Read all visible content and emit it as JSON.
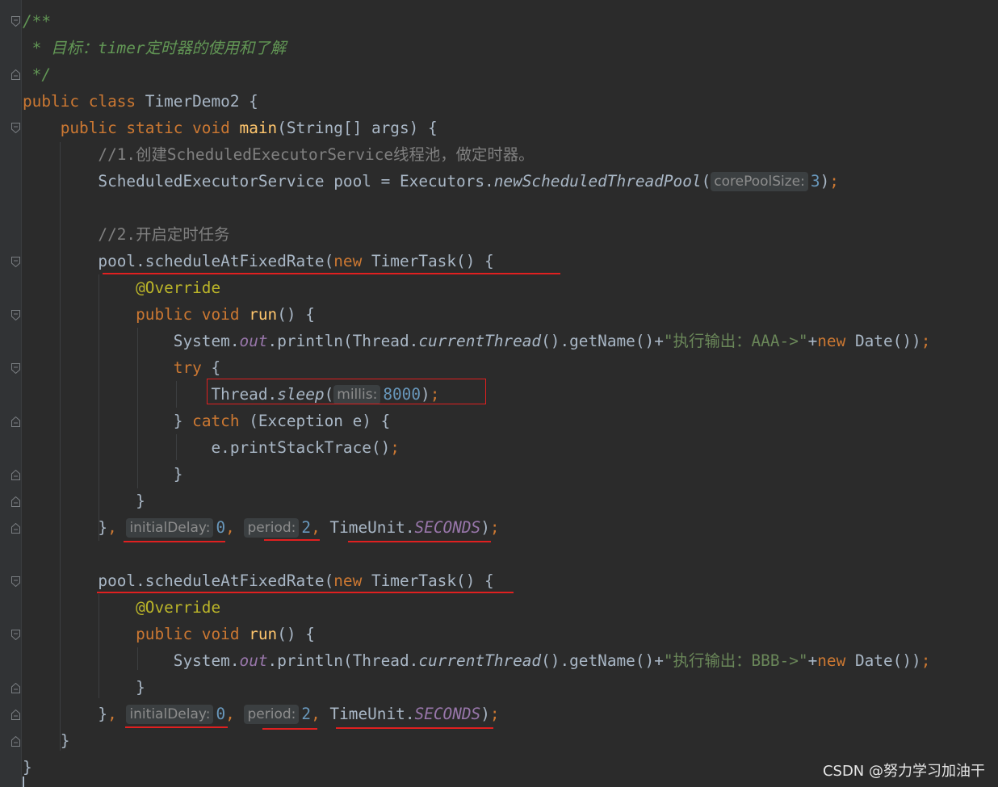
{
  "colors": {
    "background": "#2b2b2b",
    "keyword": "#cc7832",
    "doc_comment": "#629755",
    "line_comment": "#808080",
    "method_decl": "#ffc66d",
    "static_field": "#9876aa",
    "number": "#6897bb",
    "string": "#6a8759",
    "annotation": "#bbb529",
    "plain": "#a9b7c6",
    "highlight": "#e02020"
  },
  "editor": {
    "lines": [
      {
        "i": 0,
        "tokens": [
          {
            "t": "/**",
            "c": "doc_comment",
            "it": true
          }
        ]
      },
      {
        "i": 1,
        "tokens": [
          {
            "t": " * 目标：timer定时器的使用和了解",
            "c": "doc_comment",
            "it": true
          }
        ]
      },
      {
        "i": 2,
        "tokens": [
          {
            "t": " */",
            "c": "doc_comment",
            "it": true
          }
        ]
      },
      {
        "i": 3,
        "tokens": [
          {
            "t": "public class ",
            "c": "keyword"
          },
          {
            "t": "TimerDemo2 {",
            "c": "plain"
          }
        ]
      },
      {
        "i": 4,
        "tokens": [
          {
            "t": "    public static void ",
            "c": "keyword"
          },
          {
            "t": "main",
            "c": "method_decl"
          },
          {
            "t": "(String[] args) {",
            "c": "plain"
          }
        ]
      },
      {
        "i": 5,
        "tokens": [
          {
            "t": "        //1.创建ScheduledExecutorService线程池，做定时器。",
            "c": "line_comment"
          }
        ]
      },
      {
        "i": 6,
        "tokens": [
          {
            "t": "        ScheduledExecutorService pool = Executors.",
            "c": "plain"
          },
          {
            "t": "newScheduledThreadPool",
            "c": "plain",
            "it": true
          },
          {
            "t": "(",
            "c": "plain"
          },
          {
            "hint": "corePoolSize:"
          },
          {
            "t": "3",
            "c": "number"
          },
          {
            "t": ")",
            "c": "plain"
          },
          {
            "t": ";",
            "c": "keyword"
          }
        ]
      },
      {
        "i": 7,
        "tokens": []
      },
      {
        "i": 8,
        "tokens": [
          {
            "t": "        //2.开启定时任务",
            "c": "line_comment"
          }
        ]
      },
      {
        "i": 9,
        "tokens": [
          {
            "t": "        pool.scheduleAtFixedRate(",
            "c": "plain"
          },
          {
            "t": "new ",
            "c": "keyword"
          },
          {
            "t": "TimerTask() {",
            "c": "plain"
          }
        ]
      },
      {
        "i": 10,
        "tokens": [
          {
            "t": "            @Override",
            "c": "annotation"
          }
        ]
      },
      {
        "i": 11,
        "tokens": [
          {
            "t": "            public void ",
            "c": "keyword"
          },
          {
            "t": "run",
            "c": "method_decl"
          },
          {
            "t": "() {",
            "c": "plain"
          }
        ]
      },
      {
        "i": 12,
        "tokens": [
          {
            "t": "                System.",
            "c": "plain"
          },
          {
            "t": "out",
            "c": "static_field",
            "it": true
          },
          {
            "t": ".println(Thread.",
            "c": "plain"
          },
          {
            "t": "currentThread",
            "c": "plain",
            "it": true
          },
          {
            "t": "().getName()+",
            "c": "plain"
          },
          {
            "t": "\"执行输出：AAA->\"",
            "c": "string"
          },
          {
            "t": "+",
            "c": "plain"
          },
          {
            "t": "new ",
            "c": "keyword"
          },
          {
            "t": "Date())",
            "c": "plain"
          },
          {
            "t": ";",
            "c": "keyword"
          }
        ]
      },
      {
        "i": 13,
        "tokens": [
          {
            "t": "                try ",
            "c": "keyword"
          },
          {
            "t": "{",
            "c": "plain"
          }
        ]
      },
      {
        "i": 14,
        "tokens": [
          {
            "t": "                    Thread.",
            "c": "plain"
          },
          {
            "t": "sleep",
            "c": "plain",
            "it": true
          },
          {
            "t": "(",
            "c": "plain"
          },
          {
            "hint": "millis:"
          },
          {
            "t": "8000",
            "c": "number"
          },
          {
            "t": ")",
            "c": "plain"
          },
          {
            "t": ";",
            "c": "keyword"
          }
        ]
      },
      {
        "i": 15,
        "tokens": [
          {
            "t": "                } ",
            "c": "plain"
          },
          {
            "t": "catch ",
            "c": "keyword"
          },
          {
            "t": "(Exception e) {",
            "c": "plain"
          }
        ]
      },
      {
        "i": 16,
        "tokens": [
          {
            "t": "                    e.printStackTrace()",
            "c": "plain"
          },
          {
            "t": ";",
            "c": "keyword"
          }
        ]
      },
      {
        "i": 17,
        "tokens": [
          {
            "t": "                }",
            "c": "plain"
          }
        ]
      },
      {
        "i": 18,
        "tokens": [
          {
            "t": "            }",
            "c": "plain"
          }
        ]
      },
      {
        "i": 19,
        "tokens": [
          {
            "t": "        }",
            "c": "plain"
          },
          {
            "t": ", ",
            "c": "keyword"
          },
          {
            "hint": "initialDelay:"
          },
          {
            "t": "0",
            "c": "number"
          },
          {
            "t": ", ",
            "c": "keyword"
          },
          {
            "hint": "period:"
          },
          {
            "t": "2",
            "c": "number"
          },
          {
            "t": ", ",
            "c": "keyword"
          },
          {
            "t": "TimeUnit.",
            "c": "plain"
          },
          {
            "t": "SECONDS",
            "c": "static_field",
            "it": true
          },
          {
            "t": ")",
            "c": "plain"
          },
          {
            "t": ";",
            "c": "keyword"
          }
        ]
      },
      {
        "i": 20,
        "tokens": []
      },
      {
        "i": 21,
        "tokens": [
          {
            "t": "        pool.scheduleAtFixedRate(",
            "c": "plain"
          },
          {
            "t": "new ",
            "c": "keyword"
          },
          {
            "t": "TimerTask() {",
            "c": "plain"
          }
        ]
      },
      {
        "i": 22,
        "tokens": [
          {
            "t": "            @Override",
            "c": "annotation"
          }
        ]
      },
      {
        "i": 23,
        "tokens": [
          {
            "t": "            public void ",
            "c": "keyword"
          },
          {
            "t": "run",
            "c": "method_decl"
          },
          {
            "t": "() {",
            "c": "plain"
          }
        ]
      },
      {
        "i": 24,
        "tokens": [
          {
            "t": "                System.",
            "c": "plain"
          },
          {
            "t": "out",
            "c": "static_field",
            "it": true
          },
          {
            "t": ".println(Thread.",
            "c": "plain"
          },
          {
            "t": "currentThread",
            "c": "plain",
            "it": true
          },
          {
            "t": "().getName()+",
            "c": "plain"
          },
          {
            "t": "\"执行输出：BBB->\"",
            "c": "string"
          },
          {
            "t": "+",
            "c": "plain"
          },
          {
            "t": "new ",
            "c": "keyword"
          },
          {
            "t": "Date())",
            "c": "plain"
          },
          {
            "t": ";",
            "c": "keyword"
          }
        ]
      },
      {
        "i": 25,
        "tokens": [
          {
            "t": "            }",
            "c": "plain"
          }
        ]
      },
      {
        "i": 26,
        "tokens": [
          {
            "t": "        }",
            "c": "plain"
          },
          {
            "t": ", ",
            "c": "keyword"
          },
          {
            "hint": "initialDelay:"
          },
          {
            "t": "0",
            "c": "number"
          },
          {
            "t": ", ",
            "c": "keyword"
          },
          {
            "hint": "period:"
          },
          {
            "t": "2",
            "c": "number"
          },
          {
            "t": ", ",
            "c": "keyword"
          },
          {
            "t": "TimeUnit.",
            "c": "plain"
          },
          {
            "t": "SECONDS",
            "c": "static_field",
            "it": true
          },
          {
            "t": ")",
            "c": "plain"
          },
          {
            "t": ";",
            "c": "keyword"
          }
        ]
      },
      {
        "i": 27,
        "tokens": [
          {
            "t": "    }",
            "c": "plain"
          }
        ]
      },
      {
        "i": 28,
        "tokens": [
          {
            "t": "}",
            "c": "plain"
          }
        ]
      }
    ]
  },
  "watermark": "CSDN @努力学习加油干"
}
